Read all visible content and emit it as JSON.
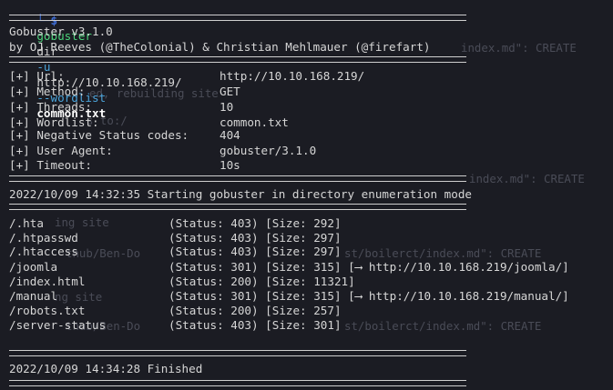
{
  "prompt": {
    "arrow": "└─$",
    "command": "gobuster",
    "subcommand": "dir",
    "url_flag": "-u",
    "url": "http://10.10.168.219/",
    "wordlist_flag": "--wordlist",
    "wordlist": "common.txt"
  },
  "banner": {
    "version": "Gobuster v3.1.0",
    "authors": "by OJ Reeves (@TheColonial) & Christian Mehlmauer (@firefart)"
  },
  "config": [
    {
      "key": "[+] Url:",
      "value": "http://10.10.168.219/"
    },
    {
      "key": "[+] Method:",
      "value": "GET"
    },
    {
      "key": "[+] Threads:",
      "value": "10"
    },
    {
      "key": "[+] Wordlist:",
      "value": "common.txt"
    },
    {
      "key": "[+] Negative Status codes:",
      "value": "404"
    },
    {
      "key": "[+] User Agent:",
      "value": "gobuster/3.1.0"
    },
    {
      "key": "[+] Timeout:",
      "value": "10s"
    }
  ],
  "start_message": "2022/10/09 14:32:35 Starting gobuster in directory enumeration mode",
  "results": [
    {
      "path": "/.hta",
      "info": "(Status: 403) [Size: 292]"
    },
    {
      "path": "/.htpasswd",
      "info": "(Status: 403) [Size: 297]"
    },
    {
      "path": "/.htaccess",
      "info": "(Status: 403) [Size: 297]"
    },
    {
      "path": "/joomla",
      "info": "(Status: 301) [Size: 315] [⟶ http://10.10.168.219/joomla/]"
    },
    {
      "path": "/index.html",
      "info": "(Status: 200) [Size: 11321]"
    },
    {
      "path": "/manual",
      "info": "(Status: 301) [Size: 315] [⟶ http://10.10.168.219/manual/]"
    },
    {
      "path": "/robots.txt",
      "info": "(Status: 200) [Size: 257]"
    },
    {
      "path": "/server-status",
      "info": "(Status: 403) [Size: 301]"
    }
  ],
  "finish_message": "2022/10/09 14:34:28 Finished",
  "ghost_text": [
    "index.md\": CREATE",
    "ed, rebuilding site",
    "s to:/",
    "index.md\": CREATE",
    "ing site",
    "thub/Ben-Do",
    "st/boilerct/index.md\": CREATE",
    "ng site",
    "thub/Ben-Do",
    "st/boilerct/index.md\": CREATE"
  ]
}
